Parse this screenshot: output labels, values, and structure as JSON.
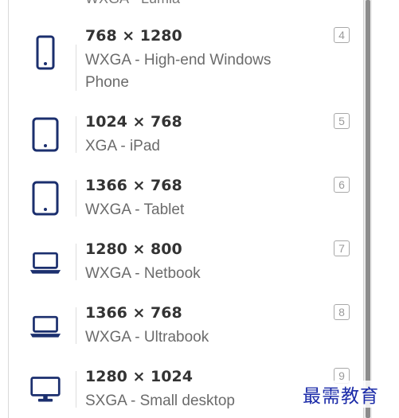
{
  "clipped_item": {
    "text": "WXGA · Lumia"
  },
  "items": [
    {
      "icon": "phone-icon",
      "resolution": "768 × 1280",
      "description": "WXGA - High-end Windows Phone",
      "shortcut": "4"
    },
    {
      "icon": "tablet-icon",
      "resolution": "1024 × 768",
      "description": "XGA - iPad",
      "shortcut": "5"
    },
    {
      "icon": "tablet-icon",
      "resolution": "1366 × 768",
      "description": "WXGA - Tablet",
      "shortcut": "6"
    },
    {
      "icon": "laptop-icon",
      "resolution": "1280 × 800",
      "description": "WXGA - Netbook",
      "shortcut": "7"
    },
    {
      "icon": "laptop-icon",
      "resolution": "1366 × 768",
      "description": "WXGA - Ultrabook",
      "shortcut": "8"
    },
    {
      "icon": "monitor-icon",
      "resolution": "1280 × 1024",
      "description": "SXGA - Small desktop",
      "shortcut": "9"
    }
  ],
  "watermark": "最需教育",
  "colors": {
    "icon": "#1b2f6e",
    "title": "#333333",
    "description": "#6b6b6b"
  }
}
